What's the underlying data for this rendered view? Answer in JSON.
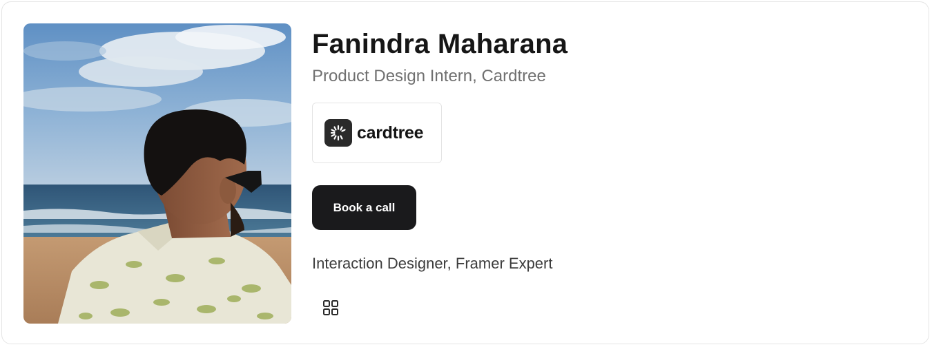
{
  "profile": {
    "name": "Fanindra Maharana",
    "role": "Product Design Intern, Cardtree",
    "tagline": "Interaction Designer, Framer Expert",
    "photo_alt": "Fanindra Maharana"
  },
  "company": {
    "name": "cardtree",
    "logo_icon": "cardtree-logo-icon"
  },
  "actions": {
    "book_call_label": "Book a call",
    "grid_icon": "grid-icon"
  },
  "colors": {
    "button_bg": "#1a1a1c",
    "button_text": "#ffffff",
    "name_text": "#161616",
    "role_text": "#707070",
    "border": "#e4e4e4"
  }
}
